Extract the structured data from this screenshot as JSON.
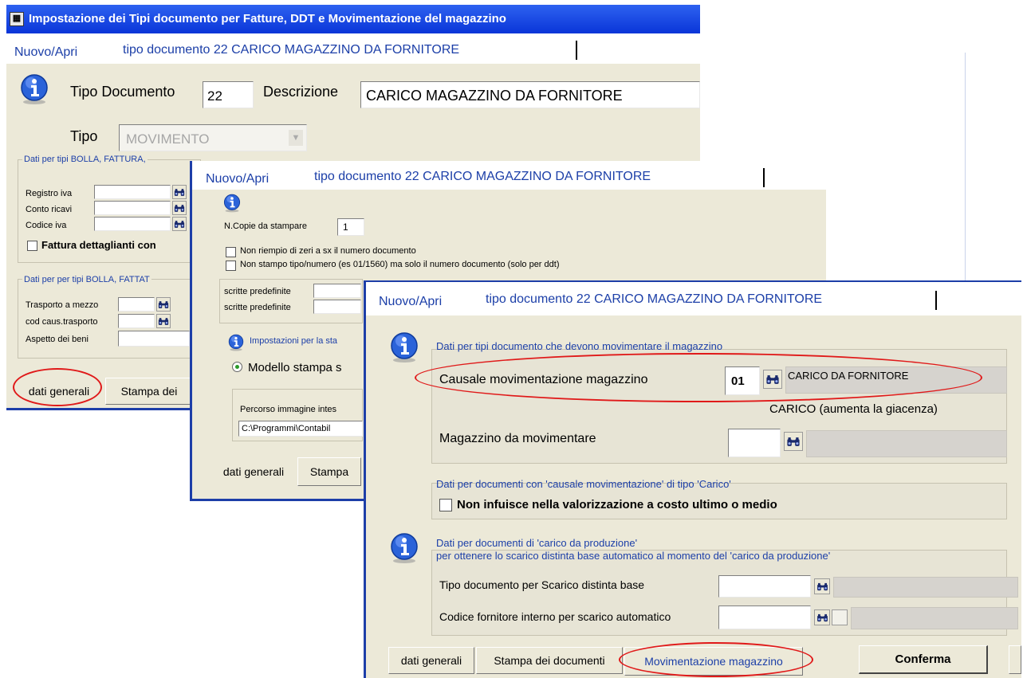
{
  "window": {
    "title": "Impostazione dei Tipi documento per Fatture, DDT e Movimentazione del magazzino"
  },
  "w1": {
    "tab_new": "Nuovo/Apri",
    "tab_doc": "tipo documento 22 CARICO MAGAZZINO DA FORNITORE",
    "tipo_documento_label": "Tipo Documento",
    "tipo_documento_value": "22",
    "descrizione_label": "Descrizione",
    "descrizione_value": "CARICO MAGAZZINO DA FORNITORE",
    "tipo_label": "Tipo",
    "tipo_value": "MOVIMENTO",
    "frame1_title": "Dati per tipi BOLLA, FATTURA,",
    "registro_iva": "Registro iva",
    "conto_ricavi": "Conto ricavi",
    "codice_iva": "Codice iva",
    "fattura_dettaglianti": "Fattura dettaglianti con",
    "frame2_title": "Dati per per tipi BOLLA, FATTAT",
    "trasporto": "Trasporto a mezzo",
    "cod_caus_trasporto": "cod caus.trasporto",
    "aspetto_beni": "Aspetto dei beni",
    "bottom_tab_dati": "dati generali",
    "bottom_tab_stampa": "Stampa dei"
  },
  "w2": {
    "tab_new": "Nuovo/Apri",
    "tab_doc": "tipo documento 22 CARICO MAGAZZINO DA FORNITORE",
    "ncopie_label": "N.Copie da stampare",
    "ncopie_value": "1",
    "check1": "Non riempio di zeri a sx il numero documento",
    "check2": "Non stampo tipo/numero (es 01/1560) ma solo il numero documento (solo per ddt)",
    "scritte1": "scritte predefinite",
    "scritte2": "scritte predefinite",
    "impostazioni": "Impostazioni per la sta",
    "modello": "Modello stampa s",
    "percorso_label": "Percorso immagine intes",
    "percorso_value": "C:\\Programmi\\Contabil",
    "bottom_tab_dati": "dati generali",
    "bottom_tab_stampa": "Stampa"
  },
  "w3": {
    "tab_new": "Nuovo/Apri",
    "tab_doc": "tipo documento 22 CARICO MAGAZZINO DA FORNITORE",
    "frame1_title": "Dati per tipi documento che devono movimentare il magazzino",
    "causale_label": "Causale movimentazione magazzino",
    "causale_code": "01",
    "causale_desc": "CARICO DA FORNITORE",
    "causale_note": "CARICO (aumenta la giacenza)",
    "magazzino_label": "Magazzino da movimentare",
    "frame2_title": "Dati per documenti con 'causale movimentazione' di tipo 'Carico'",
    "non_infuisce": "Non infuisce nella valorizzazione a costo ultimo o medio",
    "frame3_title1": "Dati per documenti di 'carico da produzione'",
    "frame3_title2": "per ottenere lo scarico distinta base automatico al momento del 'carico da produzione'",
    "tipo_doc_scarico": "Tipo documento per Scarico distinta base",
    "codice_fornitore": "Codice fornitore interno per scarico automatico",
    "bottom_tab_dati": "dati generali",
    "bottom_tab_stampa": "Stampa dei documenti",
    "bottom_tab_mov": "Movimentazione magazzino",
    "confirm_button": "Conferma"
  },
  "colors": {
    "titlebar": "#0a35d8",
    "panel": "#ECE9D8",
    "highlight_oval": "#e01919",
    "label_blue": "#1c3fa8"
  }
}
